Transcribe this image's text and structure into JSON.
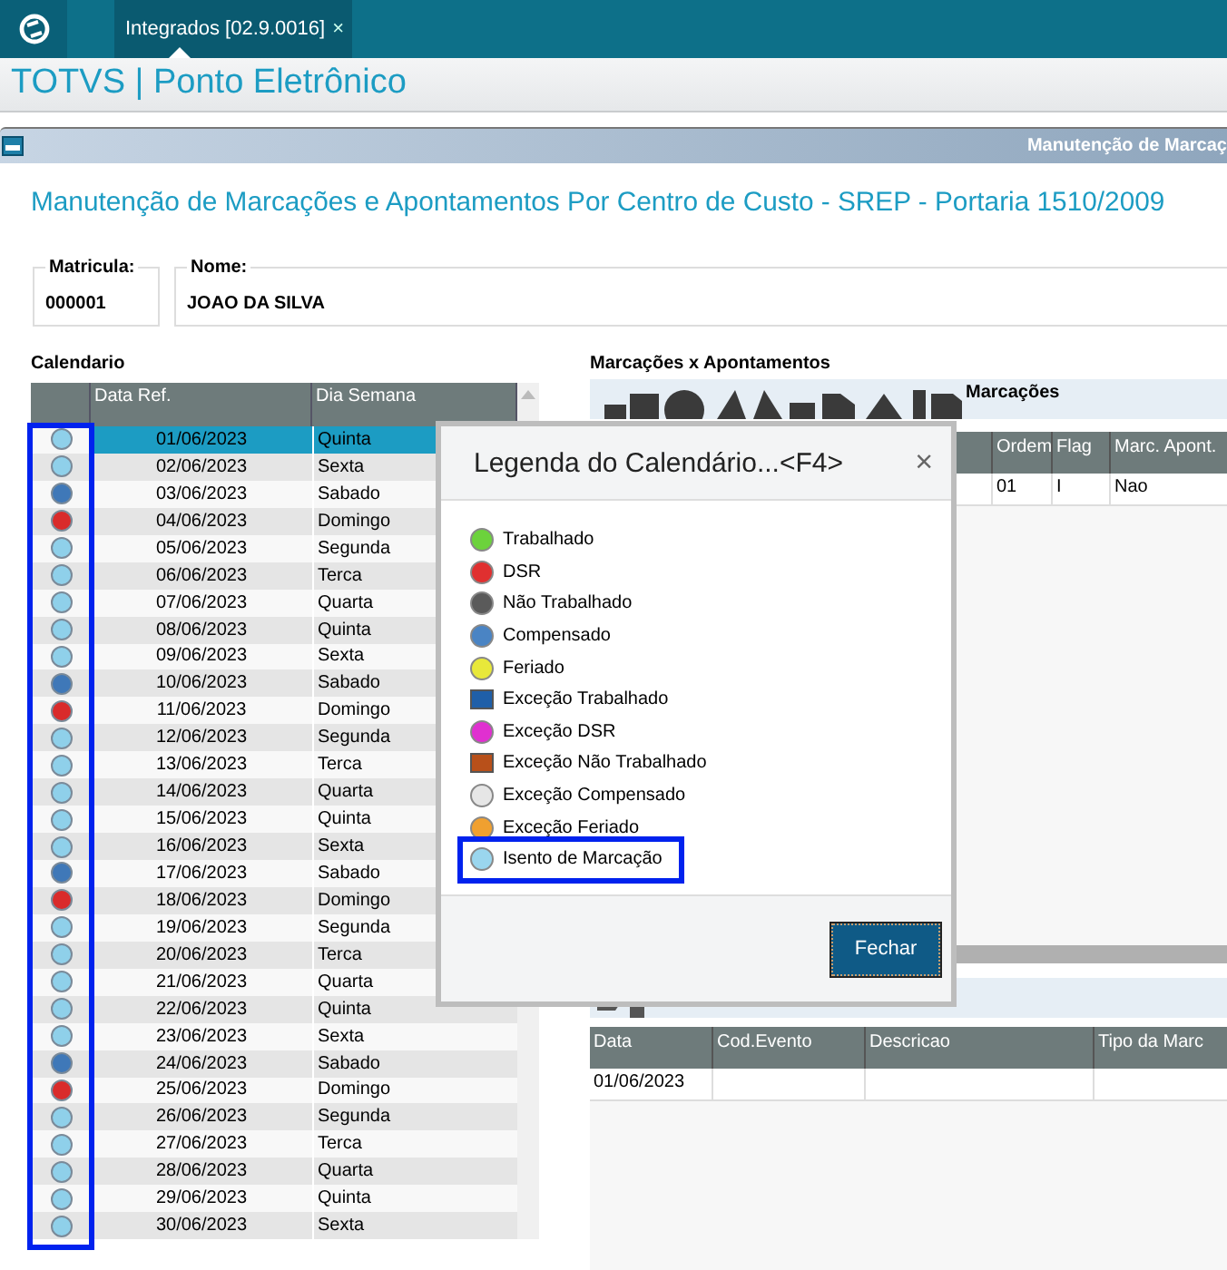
{
  "app_bar": {
    "tabs": [
      {
        "label": "Integrados [02.9.0016]",
        "selected": true,
        "close": "×"
      }
    ]
  },
  "product_title": "TOTVS | Ponto Eletrônico",
  "window": {
    "header_title": "Manutenção de Marcaç",
    "title": "Manutenção de Marcações e Apontamentos Por Centro de Custo - SREP - Portaria 1510/2009"
  },
  "fields": [
    {
      "label": "Matricula:",
      "value": "000001"
    },
    {
      "label": "Nome:",
      "value": "JOAO DA SILVA"
    }
  ],
  "calendar": {
    "label": "Calendario",
    "status_highlighted": true,
    "columns": [
      "Data Ref.",
      "Dia Semana"
    ],
    "rows": [
      {
        "date": "01/06/2023",
        "day": "Quinta",
        "color": "#8fd0ea",
        "selected": true
      },
      {
        "date": "02/06/2023",
        "day": "Sexta",
        "color": "#8fd0ea",
        "selected": false
      },
      {
        "date": "03/06/2023",
        "day": "Sabado",
        "color": "#3f78b8",
        "selected": false
      },
      {
        "date": "04/06/2023",
        "day": "Domingo",
        "color": "#d92b2b",
        "selected": false
      },
      {
        "date": "05/06/2023",
        "day": "Segunda",
        "color": "#8fd0ea",
        "selected": false
      },
      {
        "date": "06/06/2023",
        "day": "Terca",
        "color": "#8fd0ea",
        "selected": false
      },
      {
        "date": "07/06/2023",
        "day": "Quarta",
        "color": "#8fd0ea",
        "selected": false
      },
      {
        "date": "08/06/2023",
        "day": "Quinta",
        "color": "#8fd0ea",
        "selected": false
      },
      {
        "date": "09/06/2023",
        "day": "Sexta",
        "color": "#8fd0ea",
        "selected": false
      },
      {
        "date": "10/06/2023",
        "day": "Sabado",
        "color": "#3f78b8",
        "selected": false
      },
      {
        "date": "11/06/2023",
        "day": "Domingo",
        "color": "#d92b2b",
        "selected": false
      },
      {
        "date": "12/06/2023",
        "day": "Segunda",
        "color": "#8fd0ea",
        "selected": false
      },
      {
        "date": "13/06/2023",
        "day": "Terca",
        "color": "#8fd0ea",
        "selected": false
      },
      {
        "date": "14/06/2023",
        "day": "Quarta",
        "color": "#8fd0ea",
        "selected": false
      },
      {
        "date": "15/06/2023",
        "day": "Quinta",
        "color": "#8fd0ea",
        "selected": false
      },
      {
        "date": "16/06/2023",
        "day": "Sexta",
        "color": "#8fd0ea",
        "selected": false
      },
      {
        "date": "17/06/2023",
        "day": "Sabado",
        "color": "#3f78b8",
        "selected": false
      },
      {
        "date": "18/06/2023",
        "day": "Domingo",
        "color": "#d92b2b",
        "selected": false
      },
      {
        "date": "19/06/2023",
        "day": "Segunda",
        "color": "#8fd0ea",
        "selected": false
      },
      {
        "date": "20/06/2023",
        "day": "Terca",
        "color": "#8fd0ea",
        "selected": false
      },
      {
        "date": "21/06/2023",
        "day": "Quarta",
        "color": "#8fd0ea",
        "selected": false
      },
      {
        "date": "22/06/2023",
        "day": "Quinta",
        "color": "#8fd0ea",
        "selected": false
      },
      {
        "date": "23/06/2023",
        "day": "Sexta",
        "color": "#8fd0ea",
        "selected": false
      },
      {
        "date": "24/06/2023",
        "day": "Sabado",
        "color": "#3f78b8",
        "selected": false
      },
      {
        "date": "25/06/2023",
        "day": "Domingo",
        "color": "#d92b2b",
        "selected": false
      },
      {
        "date": "26/06/2023",
        "day": "Segunda",
        "color": "#8fd0ea",
        "selected": false
      },
      {
        "date": "27/06/2023",
        "day": "Terca",
        "color": "#8fd0ea",
        "selected": false
      },
      {
        "date": "28/06/2023",
        "day": "Quarta",
        "color": "#8fd0ea",
        "selected": false
      },
      {
        "date": "29/06/2023",
        "day": "Quinta",
        "color": "#8fd0ea",
        "selected": false
      },
      {
        "date": "30/06/2023",
        "day": "Sexta",
        "color": "#8fd0ea",
        "selected": false
      }
    ]
  },
  "marcacoes": {
    "label": "Marcações x Apontamentos",
    "toolbar_label": "Marcações",
    "columns": [
      "Ordem",
      "Flag",
      "Marc. Apont."
    ],
    "rows": [
      [
        "01",
        "I",
        "Nao"
      ]
    ]
  },
  "apontamentos": {
    "columns": [
      "Data",
      "Cod.Evento",
      "Descricao",
      "Tipo da Marc"
    ],
    "rows": [
      [
        "01/06/2023",
        "",
        "",
        ""
      ]
    ]
  },
  "dialog": {
    "title": "Legenda do Calendário...<F4>",
    "close": "×",
    "items": [
      {
        "label": "Trabalhado",
        "kind": "dot",
        "color": "#6cd23c",
        "highlighted": false
      },
      {
        "label": "DSR",
        "kind": "dot",
        "color": "#e03030",
        "highlighted": false
      },
      {
        "label": "Não Trabalhado",
        "kind": "dot",
        "color": "#5a5a5a",
        "highlighted": false
      },
      {
        "label": "Compensado",
        "kind": "dot",
        "color": "#4a84c4",
        "highlighted": false
      },
      {
        "label": "Feriado",
        "kind": "dot",
        "color": "#e8e83a",
        "highlighted": false
      },
      {
        "label": "Exceção Trabalhado",
        "kind": "square",
        "color": "#1f5fa8",
        "highlighted": false
      },
      {
        "label": "Exceção DSR",
        "kind": "dot",
        "color": "#e030d0",
        "highlighted": false
      },
      {
        "label": "Exceção Não Trabalhado",
        "kind": "square",
        "color": "#b8501a",
        "highlighted": false
      },
      {
        "label": "Exceção Compensado",
        "kind": "dot",
        "color": "#e6e6e6",
        "highlighted": false
      },
      {
        "label": "Exceção Feriado",
        "kind": "dot",
        "color": "#f0a030",
        "highlighted": false
      },
      {
        "label": "Isento de Marcação",
        "kind": "dot",
        "color": "#9ad6ee",
        "highlighted": true
      }
    ],
    "button": "Fechar"
  }
}
